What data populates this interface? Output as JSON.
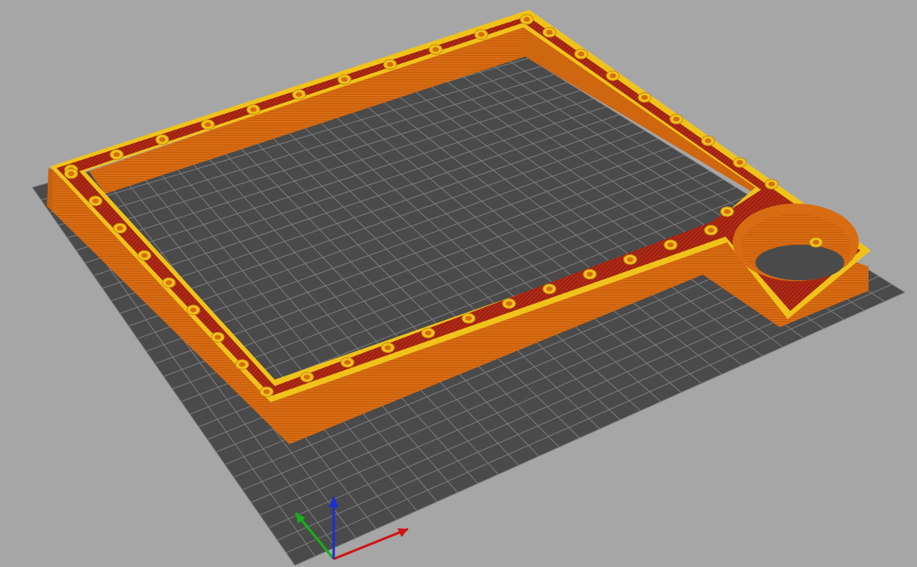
{
  "viewport": {
    "background_color": "#a6a6a6"
  },
  "bed": {
    "plate_color": "#4a4a4a",
    "grid_color": "#7c7c7c",
    "grid_divisions": 30
  },
  "model": {
    "wall_color": "#d86c12",
    "wall_dark_color": "#b9560c",
    "top_perimeter_color": "#f0c31a",
    "infill_color": "#9e2112",
    "hole_count": 44,
    "cylinder_cutout": "round-cutout"
  },
  "axes": {
    "x_color": "#d11313",
    "y_color": "#14b414",
    "z_color": "#1a2ed6",
    "icons": [
      "x-axis-arrow",
      "y-axis-arrow",
      "z-axis-arrow"
    ]
  }
}
